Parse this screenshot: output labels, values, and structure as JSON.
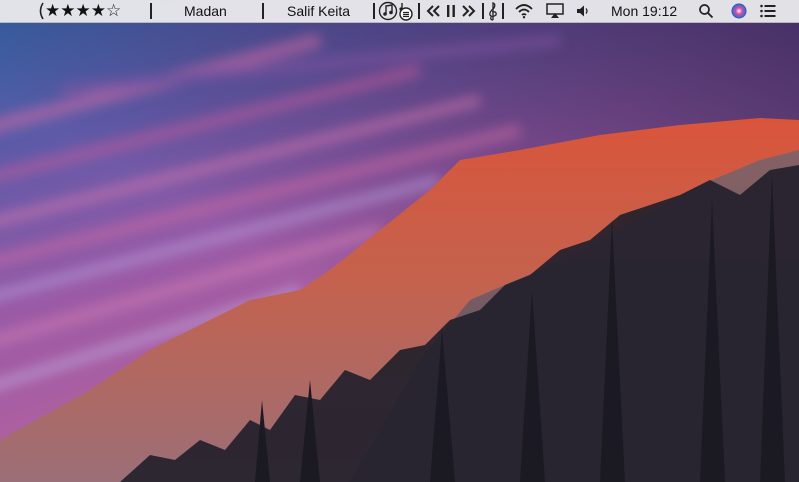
{
  "menubar": {
    "rating": {
      "value": 4,
      "max": 5,
      "filled_star": "★",
      "empty_star": "☆"
    },
    "track_title": "Madan",
    "artist": "Salif Keita",
    "clock": "Mon 19:12",
    "icons": [
      "bracket-left-icon",
      "music-note-icon",
      "lyrics-icon",
      "previous-track-icon",
      "pause-icon",
      "next-track-icon",
      "treble-clef-icon",
      "wifi-icon",
      "airplay-icon",
      "volume-icon",
      "search-icon",
      "siri-icon",
      "notification-center-icon"
    ]
  },
  "colors": {
    "menubar_bg": "#ececee",
    "sky_top": "#2d5f9c",
    "sky_pink": "#c25690",
    "mountain_lit": "#d25a3c",
    "mountain_shadow": "#6b5a6b",
    "forest": "#1f1e26"
  }
}
